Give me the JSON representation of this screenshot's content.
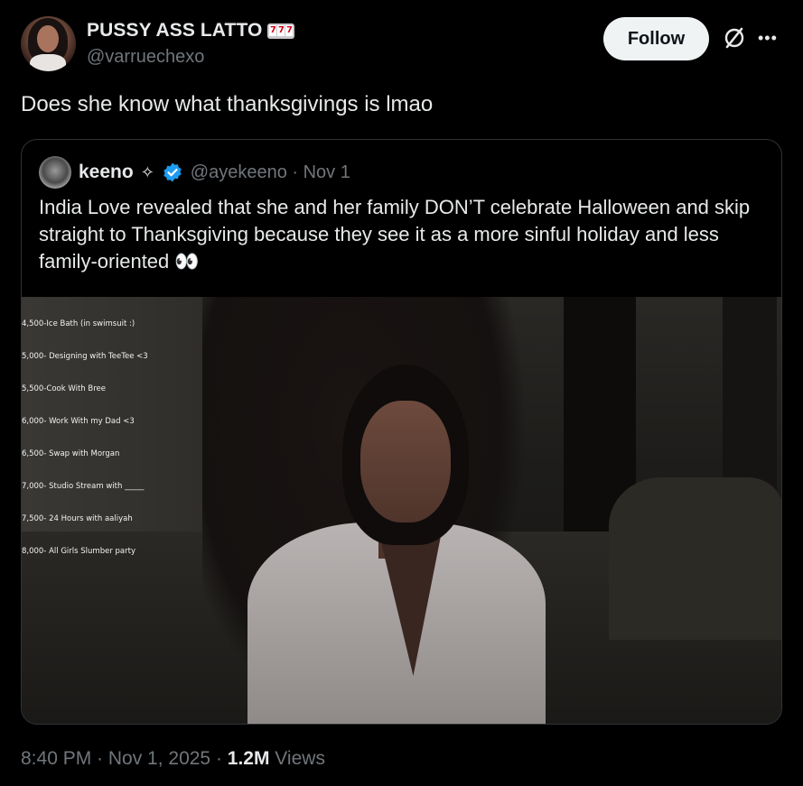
{
  "post": {
    "author": {
      "display_name": "PUSSY ASS LATTO",
      "emoji_icon": "slot-machine-icon",
      "emoji_glyph": "777",
      "handle": "@varruechexo"
    },
    "follow_label": "Follow",
    "text": "Does she know what thanksgivings is lmao",
    "timestamp": "8:40 PM · Nov 1, 2025 · ",
    "views_count": "1.2M",
    "views_label": " Views"
  },
  "quote": {
    "author": {
      "display_name": "keeno",
      "sparkle": "✧",
      "handle": "@ayekeeno · Nov 1"
    },
    "text": "India Love revealed that she and her family DON’T celebrate Halloween and skip straight to Thanksgiving because they see it as a more sinful holiday and less family-oriented 👀",
    "media_overlay_lines": [
      "4,500-Ice Bath (in swimsuit :)",
      "5,000- Designing with TeeTee <3",
      "5,500-Cook With Bree",
      "6,000- Work With my Dad <3",
      "6,500- Swap with Morgan",
      "7,000- Studio Stream with _____",
      "7,500- 24 Hours with aaliyah",
      "8,000- All Girls Slumber party"
    ]
  },
  "colors": {
    "background": "#000000",
    "text_primary": "#e7e9ea",
    "text_secondary": "#71767b",
    "border": "#2f3336",
    "verified": "#1d9bf0",
    "follow_bg": "#eff3f4"
  }
}
